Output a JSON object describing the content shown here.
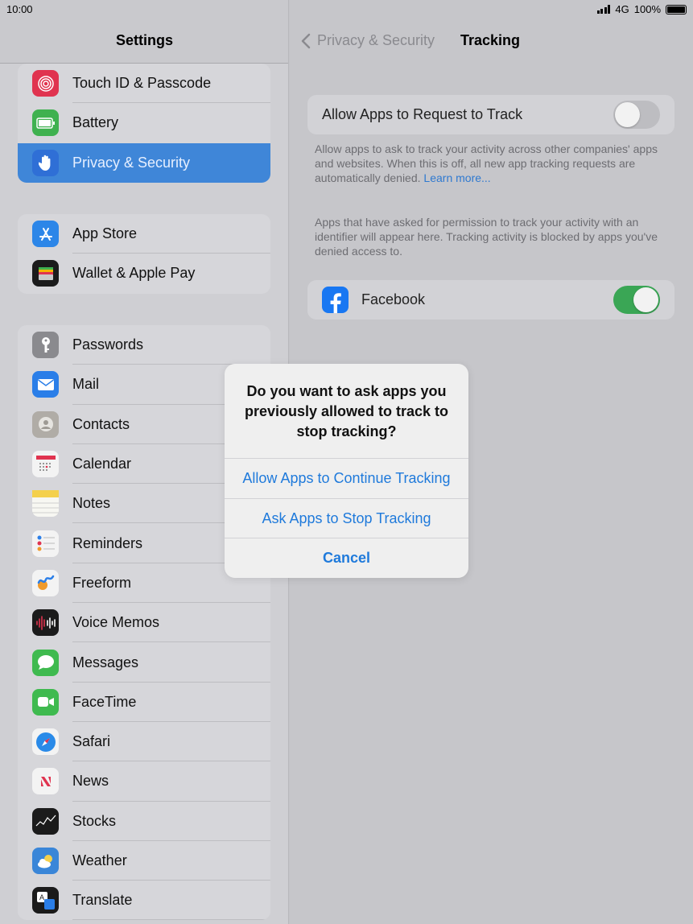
{
  "status": {
    "time": "10:00",
    "network": "4G",
    "battery": "100%"
  },
  "sidebar": {
    "title": "Settings",
    "group1": [
      {
        "label": "Touch ID & Passcode",
        "icon": "fingerprint-icon",
        "color": "#e0334f"
      },
      {
        "label": "Battery",
        "icon": "battery-icon",
        "color": "#3fb14f"
      },
      {
        "label": "Privacy & Security",
        "icon": "hand-icon",
        "color": "#2f6fd6",
        "selected": true
      }
    ],
    "group2": [
      {
        "label": "App Store",
        "icon": "app-store-icon",
        "color": "#2c86e8"
      },
      {
        "label": "Wallet & Apple Pay",
        "icon": "wallet-icon",
        "color": "#1b1b1b"
      }
    ],
    "group3": [
      {
        "label": "Passwords",
        "icon": "key-icon",
        "color": "#8a8a8e"
      },
      {
        "label": "Mail",
        "icon": "mail-icon",
        "color": "#2a7ee8"
      },
      {
        "label": "Contacts",
        "icon": "contacts-icon",
        "color": "#b0aca6"
      },
      {
        "label": "Calendar",
        "icon": "calendar-icon",
        "color": "#f3f3f3"
      },
      {
        "label": "Notes",
        "icon": "notes-icon",
        "color": "#f4d04c"
      },
      {
        "label": "Reminders",
        "icon": "reminders-icon",
        "color": "#f3f3f3"
      },
      {
        "label": "Freeform",
        "icon": "freeform-icon",
        "color": "#f3f3f3"
      },
      {
        "label": "Voice Memos",
        "icon": "voice-memos-icon",
        "color": "#1b1b1b"
      },
      {
        "label": "Messages",
        "icon": "messages-icon",
        "color": "#3fba4f"
      },
      {
        "label": "FaceTime",
        "icon": "facetime-icon",
        "color": "#3fba4f"
      },
      {
        "label": "Safari",
        "icon": "safari-icon",
        "color": "#f3f3f3"
      },
      {
        "label": "News",
        "icon": "news-icon",
        "color": "#f3f3f3"
      },
      {
        "label": "Stocks",
        "icon": "stocks-icon",
        "color": "#1b1b1b"
      },
      {
        "label": "Weather",
        "icon": "weather-icon",
        "color": "#3a86d8"
      },
      {
        "label": "Translate",
        "icon": "translate-icon",
        "color": "#1b1b1b"
      }
    ]
  },
  "detail": {
    "back_label": "Privacy & Security",
    "title": "Tracking",
    "allow_toggle": {
      "label": "Allow Apps to Request to Track",
      "state": "off"
    },
    "allow_footnote": "Allow apps to ask to track your activity across other companies' apps and websites. When this is off, all new app tracking requests are automatically denied. ",
    "learn_more": "Learn more...",
    "apps_note": "Apps that have asked for permission to track your activity with an identifier will appear here. Tracking activity is blocked by apps you've denied access to.",
    "apps": [
      {
        "label": "Facebook",
        "icon": "facebook-icon",
        "state": "on"
      }
    ]
  },
  "alert": {
    "title": "Do you want to ask apps you previously allowed to track to stop tracking?",
    "buttons": [
      {
        "label": "Allow Apps to Continue Tracking",
        "bold": false
      },
      {
        "label": "Ask Apps to Stop Tracking",
        "bold": false
      },
      {
        "label": "Cancel",
        "bold": true
      }
    ]
  },
  "colors": {
    "accent": "#1f7adb",
    "selected_row": "#3f86d8",
    "toggle_on": "#3aa655"
  }
}
